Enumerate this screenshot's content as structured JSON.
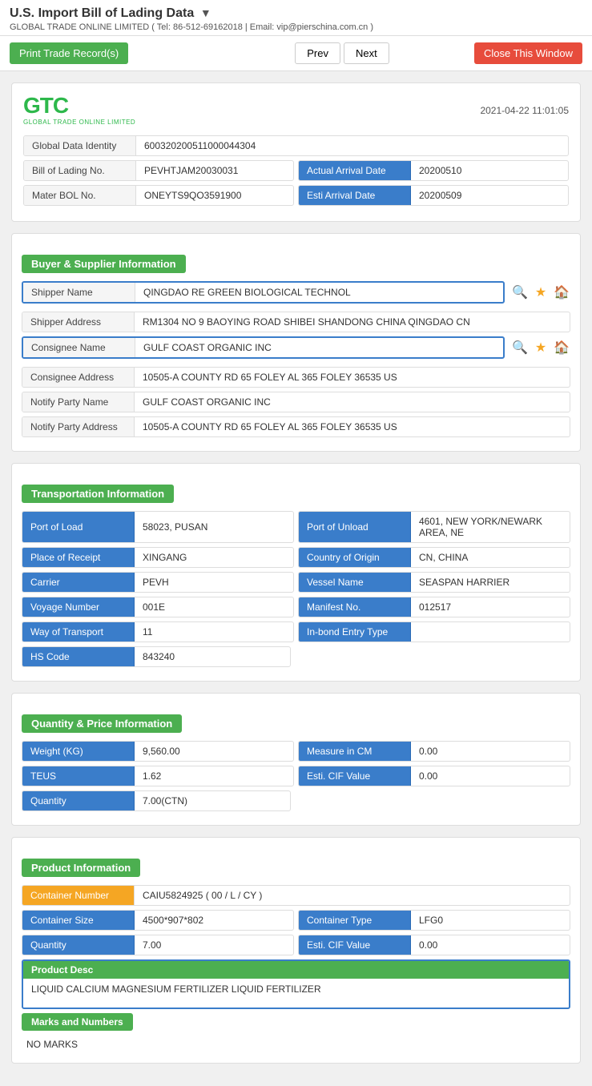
{
  "header": {
    "title": "U.S. Import Bill of Lading Data",
    "arrow": "▼",
    "subtitle": "GLOBAL TRADE ONLINE LIMITED ( Tel: 86-512-69162018 | Email: vip@pierschina.com.cn )"
  },
  "toolbar": {
    "print_label": "Print Trade Record(s)",
    "prev_label": "Prev",
    "next_label": "Next",
    "close_label": "Close This Window"
  },
  "record": {
    "timestamp": "2021-04-22 11:01:05",
    "global_data_identity_label": "Global Data Identity",
    "global_data_identity_value": "600320200511000044304",
    "bill_of_lading_label": "Bill of Lading No.",
    "bill_of_lading_value": "PEVHTJAM20030031",
    "actual_arrival_date_label": "Actual Arrival Date",
    "actual_arrival_date_value": "20200510",
    "mater_bol_label": "Mater BOL No.",
    "mater_bol_value": "ONEYTS9QO3591900",
    "esti_arrival_date_label": "Esti Arrival Date",
    "esti_arrival_date_value": "20200509"
  },
  "buyer_supplier": {
    "section_title": "Buyer & Supplier Information",
    "shipper_name_label": "Shipper Name",
    "shipper_name_value": "QINGDAO RE GREEN BIOLOGICAL TECHNOL",
    "shipper_address_label": "Shipper Address",
    "shipper_address_value": "RM1304 NO 9 BAOYING ROAD SHIBEI SHANDONG CHINA QINGDAO CN",
    "consignee_name_label": "Consignee Name",
    "consignee_name_value": "GULF COAST ORGANIC INC",
    "consignee_address_label": "Consignee Address",
    "consignee_address_value": "10505-A COUNTY RD 65 FOLEY AL 365 FOLEY 36535 US",
    "notify_party_name_label": "Notify Party Name",
    "notify_party_name_value": "GULF COAST ORGANIC INC",
    "notify_party_address_label": "Notify Party Address",
    "notify_party_address_value": "10505-A COUNTY RD 65 FOLEY AL 365 FOLEY 36535 US"
  },
  "transportation": {
    "section_title": "Transportation Information",
    "port_of_load_label": "Port of Load",
    "port_of_load_value": "58023, PUSAN",
    "port_of_unload_label": "Port of Unload",
    "port_of_unload_value": "4601, NEW YORK/NEWARK AREA, NE",
    "place_of_receipt_label": "Place of Receipt",
    "place_of_receipt_value": "XINGANG",
    "country_of_origin_label": "Country of Origin",
    "country_of_origin_value": "CN, CHINA",
    "carrier_label": "Carrier",
    "carrier_value": "PEVH",
    "vessel_name_label": "Vessel Name",
    "vessel_name_value": "SEASPAN HARRIER",
    "voyage_number_label": "Voyage Number",
    "voyage_number_value": "001E",
    "manifest_no_label": "Manifest No.",
    "manifest_no_value": "012517",
    "way_of_transport_label": "Way of Transport",
    "way_of_transport_value": "11",
    "in_bond_entry_type_label": "In-bond Entry Type",
    "in_bond_entry_type_value": "",
    "hs_code_label": "HS Code",
    "hs_code_value": "843240"
  },
  "quantity_price": {
    "section_title": "Quantity & Price Information",
    "weight_kg_label": "Weight (KG)",
    "weight_kg_value": "9,560.00",
    "measure_in_cm_label": "Measure in CM",
    "measure_in_cm_value": "0.00",
    "teus_label": "TEUS",
    "teus_value": "1.62",
    "esti_cif_value_label": "Esti. CIF Value",
    "esti_cif_value_1": "0.00",
    "quantity_label": "Quantity",
    "quantity_value": "7.00(CTN)"
  },
  "product": {
    "section_title": "Product Information",
    "container_number_label": "Container Number",
    "container_number_value": "CAIU5824925 ( 00 / L / CY )",
    "container_size_label": "Container Size",
    "container_size_value": "4500*907*802",
    "container_type_label": "Container Type",
    "container_type_value": "LFG0",
    "quantity_label": "Quantity",
    "quantity_value": "7.00",
    "esti_cif_value_label": "Esti. CIF Value",
    "esti_cif_value": "0.00",
    "product_desc_label": "Product Desc",
    "product_desc_value": "LIQUID CALCIUM MAGNESIUM FERTILIZER LIQUID FERTILIZER",
    "marks_and_numbers_label": "Marks and Numbers",
    "marks_value": "NO MARKS"
  },
  "icons": {
    "search": "🔍",
    "star": "★",
    "home": "🏠"
  }
}
